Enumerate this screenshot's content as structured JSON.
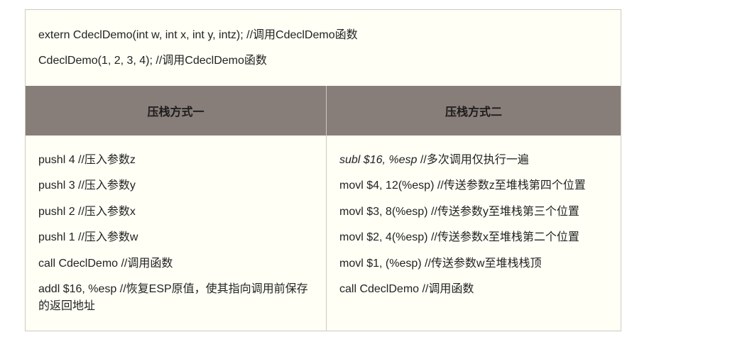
{
  "top": {
    "line1": "extern CdeclDemo(int w, int x, int y, intz);  //调用CdeclDemo函数",
    "line2": "CdeclDemo(1, 2, 3, 4);  //调用CdeclDemo函数"
  },
  "headers": {
    "left": "压栈方式一",
    "right": "压栈方式二"
  },
  "left_lines": [
    "pushl 4  //压入参数z",
    "pushl 3  //压入参数y",
    "pushl 2  //压入参数x",
    "pushl 1  //压入参数w",
    "call CdeclDemo  //调用函数",
    "addl $16, %esp  //恢复ESP原值，使其指向调用前保存的返回地址"
  ],
  "right_lines": {
    "line1_code": "subl   $16, %esp",
    "line1_comment": " //多次调用仅执行一遍",
    "line2": "movl  $4, 12(%esp) //传送参数z至堆栈第四个位置",
    "line3": "movl  $3, 8(%esp) //传送参数y至堆栈第三个位置",
    "line4": "movl  $2, 4(%esp) //传送参数x至堆栈第二个位置",
    "line5": "movl  $1, (%esp) //传送参数w至堆栈栈顶",
    "line6": "call CdeclDemo  //调用函数"
  }
}
